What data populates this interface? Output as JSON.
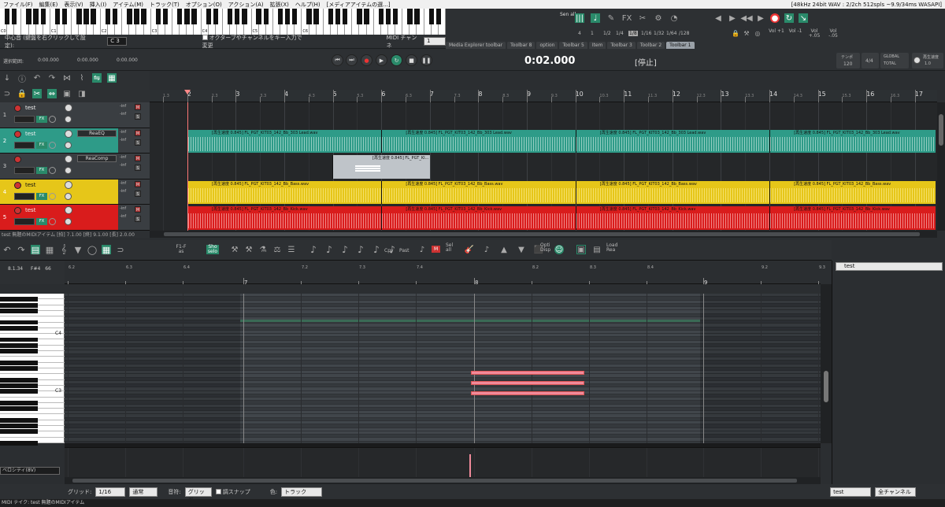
{
  "menu": [
    "ファイル(F)",
    "編集(E)",
    "表示(V)",
    "挿入(I)",
    "アイテム(M)",
    "トラック(T)",
    "オプション(O)",
    "アクション(A)",
    "拡張(X)",
    "ヘルプ(H)",
    "[メディアアイテムの選...]"
  ],
  "audio_status": "[48kHz 24bit WAV : 2/2ch 512spls ~9.9/34ms WASAPI]",
  "keyboard": {
    "octave_labels": [
      "C0",
      "C1",
      "C2",
      "C3",
      "C4",
      "C5",
      "C6"
    ],
    "center_label": "中心音 (鍵盤を右クリックして設定):",
    "center_value": "C 3",
    "octave_checkbox": "オクターブやチャンネルをキー入力で変更",
    "midi_channel_label": "MIDI チャンネ",
    "midi_channel_value": "1"
  },
  "grid_buttons": [
    "4",
    "1",
    "1/2",
    "1/4",
    "1/8",
    "1/16",
    "1/32",
    "1/64",
    "/128"
  ],
  "vol_buttons": [
    "Vol +1",
    "Vol -1",
    "Vol +.05",
    "Vol -.05"
  ],
  "sen_all": "Sen all",
  "toolbar_tabs": [
    "Media Explorer toolbar",
    "Toolbar 8",
    "option",
    "Toolbar 5",
    "Item",
    "Toolbar 3",
    "Toolbar 2",
    "Toolbar 1"
  ],
  "transport": {
    "sel_label": "選択範囲:",
    "sel_start": "0:00.000",
    "sel_end": "0:00.000",
    "sel_len": "0:00.000",
    "time": "0:02.000",
    "state": "[停止]",
    "tempo_label": "テンポ",
    "tempo": "120",
    "meter": "4/4",
    "global_label": "GLOBAL",
    "global_value": "TOTAL",
    "master_label": "再生速度",
    "master_value": "1.0"
  },
  "ruler_marks": [
    "1.3",
    "2",
    "2.3",
    "3",
    "3.3",
    "4",
    "4.3",
    "5",
    "5.3",
    "6",
    "6.3",
    "7",
    "7.3",
    "8",
    "8.3",
    "9",
    "9.3",
    "10",
    "10.3",
    "11",
    "11.3",
    "12",
    "12.3",
    "13",
    "13.3",
    "14",
    "14.3",
    "15",
    "15.3",
    "16",
    "16.3",
    "17"
  ],
  "tracks": [
    {
      "num": "1",
      "name": "test",
      "fx": "",
      "color": "#3a3e42",
      "meter": "-inf"
    },
    {
      "num": "2",
      "name": "test",
      "fx": "ReaEQ",
      "color": "#2e9b88",
      "meter": "-inf"
    },
    {
      "num": "3",
      "name": "",
      "fx": "ReaComp",
      "color": "#3a3e42",
      "meter": "-inf"
    },
    {
      "num": "4",
      "name": "test",
      "fx": "",
      "color": "#e6c619",
      "meter": "-inf"
    },
    {
      "num": "5",
      "name": "test",
      "fx": "",
      "color": "#d91c1c",
      "meter": "-inf"
    }
  ],
  "item_labels": {
    "lead": "[再生速度 0.845] FL_PGT_KIT03_142_Bb_303 Lead.wav",
    "midi": "[再生速度 0.845] FL_PGT_KI...",
    "bass": "[再生速度 0.845] FL_PGT_KIT03_142_Bb_Bass.wav",
    "kick": "[再生速度 0.845] FL_PGT_KIT03_142_Bb_Kick.wav"
  },
  "status_item": "test 無題のMIDIアイテム [拍] 7.1.00 [終] 9.1.00 [長] 2.0.00",
  "midi_toolbar": [
    "F1-F as",
    "Sho selo",
    "Cpy",
    "Past",
    "M",
    "Sel all",
    "Opti Disp",
    "Load Rea"
  ],
  "midi_info": {
    "pos": "8.1.34",
    "note": "F#4",
    "vel": "66"
  },
  "midi_ruler": [
    "6.2",
    "6.3",
    "6.4",
    "7",
    "7.2",
    "7.3",
    "7.4",
    "8",
    "8.2",
    "8.3",
    "8.4",
    "9",
    "9.2",
    "9.3"
  ],
  "piano_labels": [
    "C4",
    "C3"
  ],
  "velocity_label": "ベロシティ(8V)",
  "bottom": {
    "grid_label": "グリッド:",
    "grid_value": "1/16",
    "mode_value": "通常",
    "note_label": "音符:",
    "note_value": "グリッド",
    "snap_label": "調スナップ",
    "color_label": "色:",
    "color_value": "トラック",
    "track_select": "test",
    "channel_select": "全チャンネル"
  },
  "right_panel_track": "test",
  "statusbar": "MIDI テイク: test 無題のMIDIアイテム"
}
